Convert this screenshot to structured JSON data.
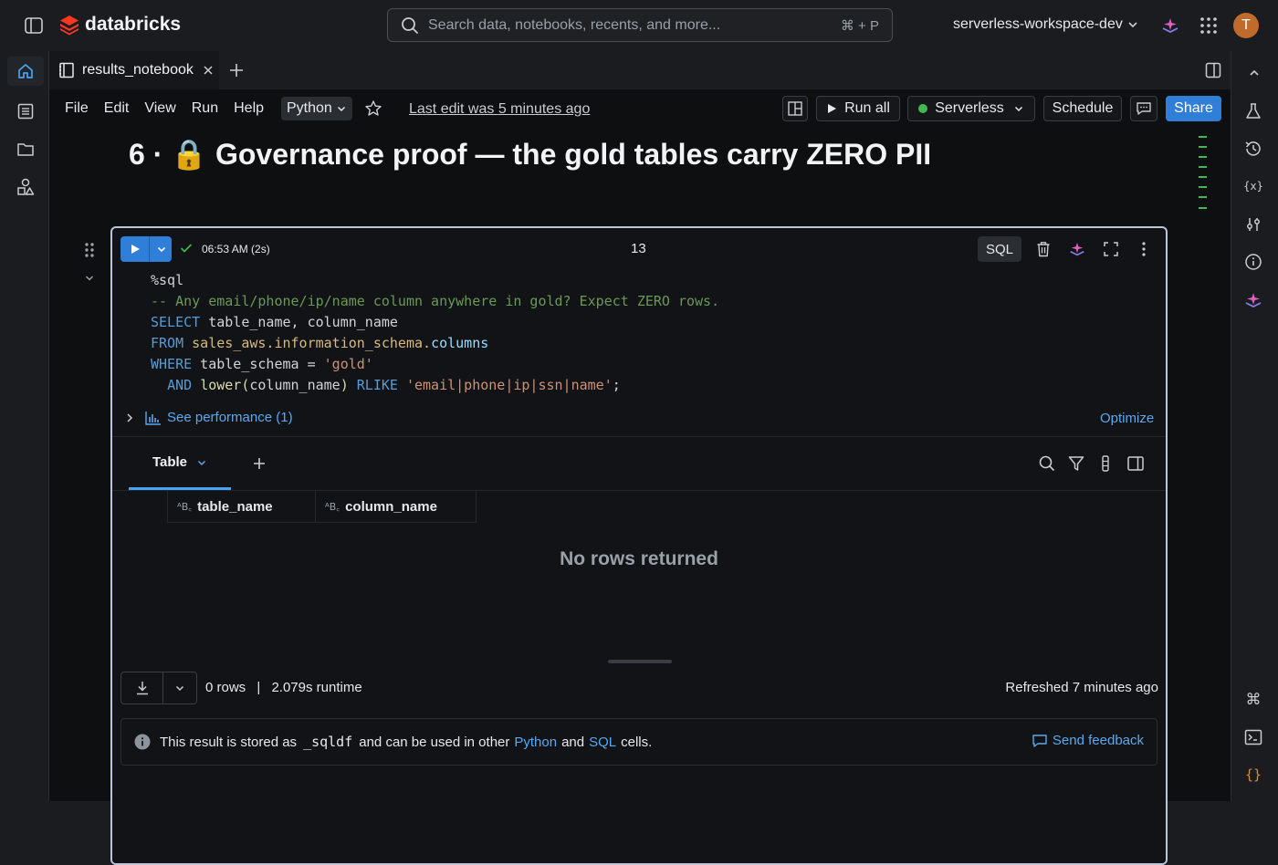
{
  "app": {
    "brand": "databricks",
    "avatar_initial": "T",
    "workspace": "serverless-workspace-dev"
  },
  "search": {
    "placeholder": "Search data, notebooks, recents, and more...",
    "shortcut": "⌘ + P"
  },
  "tab": {
    "label": "results_notebook"
  },
  "menubar": {
    "items": [
      "File",
      "Edit",
      "View",
      "Run",
      "Help"
    ],
    "language": "Python",
    "last_edit": "Last edit was 5 minutes ago",
    "run_all": "Run all",
    "compute": "Serverless",
    "schedule": "Schedule",
    "share": "Share"
  },
  "section": {
    "number": "6 ·",
    "emoji": "🔒",
    "title": "Governance proof — the gold tables carry ZERO PII"
  },
  "cell": {
    "status_time": "06:53 AM (2s)",
    "cell_number": "13",
    "lang_badge": "SQL",
    "code": {
      "line1": "%sql",
      "line2": "-- Any email/phone/ip/name column anywhere in gold? Expect ZERO rows.",
      "l3_kw": "SELECT",
      "l3_rest": " table_name, column_name",
      "l4_kw": "FROM",
      "l4_obj": "sales_aws.information_schema.",
      "l4_ident": "columns",
      "l5_kw": "WHERE",
      "l5_rest": " table_schema = ",
      "l5_str": "'gold'",
      "l6_kw": "AND",
      "l6_fn": "lower",
      "l6_paren_open": "(",
      "l6_arg": "column_name",
      "l6_paren_close": ")",
      "l6_kw2": "RLIKE",
      "l6_str": "'email|phone|ip|ssn|name'",
      "l6_end": ";"
    },
    "see_performance": "See performance (1)",
    "optimize": "Optimize"
  },
  "results": {
    "tab_label": "Table",
    "columns": [
      "table_name",
      "column_name"
    ],
    "empty_message": "No rows returned",
    "row_count": "0 rows",
    "separator": "|",
    "runtime": "2.079s runtime",
    "refreshed": "Refreshed 7 minutes ago",
    "info_prefix": "This result is stored as",
    "info_var": "_sqldf",
    "info_mid": "and can be used in other",
    "info_python": "Python",
    "info_and": "and",
    "info_sql": "SQL",
    "info_suffix": "cells.",
    "feedback": "Send feedback"
  },
  "colors": {
    "accent": "#2f7ed8",
    "brand": "#ff3621",
    "success": "#3fb950",
    "link": "#5aa9f0"
  }
}
